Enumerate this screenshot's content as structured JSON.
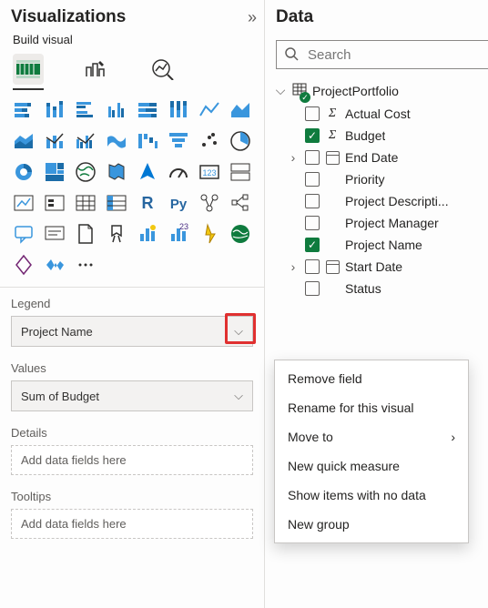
{
  "viz": {
    "title": "Visualizations",
    "subtitle": "Build visual",
    "wells": {
      "legend": {
        "label": "Legend",
        "value": "Project Name"
      },
      "values": {
        "label": "Values",
        "value": "Sum of Budget"
      },
      "details": {
        "label": "Details",
        "placeholder": "Add data fields here"
      },
      "tooltips": {
        "label": "Tooltips",
        "placeholder": "Add data fields here"
      }
    }
  },
  "data": {
    "title": "Data",
    "search_placeholder": "Search",
    "table": "ProjectPortfolio",
    "fields": [
      {
        "name": "Actual Cost",
        "checked": false,
        "sigma": true
      },
      {
        "name": "Budget",
        "checked": true,
        "sigma": true
      },
      {
        "name": "End Date",
        "checked": false,
        "date": true,
        "expandable": true
      },
      {
        "name": "Priority",
        "checked": false
      },
      {
        "name": "Project Descripti...",
        "checked": false
      },
      {
        "name": "Project Manager",
        "checked": false
      },
      {
        "name": "Project Name",
        "checked": true
      },
      {
        "name": "Start Date",
        "checked": false,
        "date": true,
        "expandable": true
      },
      {
        "name": "Status",
        "checked": false
      }
    ]
  },
  "menu": {
    "items": [
      {
        "label": "Remove field"
      },
      {
        "label": "Rename for this visual"
      },
      {
        "label": "Move to",
        "submenu": true
      },
      {
        "label": "New quick measure"
      },
      {
        "label": "Show items with no data"
      },
      {
        "label": "New group"
      }
    ]
  }
}
